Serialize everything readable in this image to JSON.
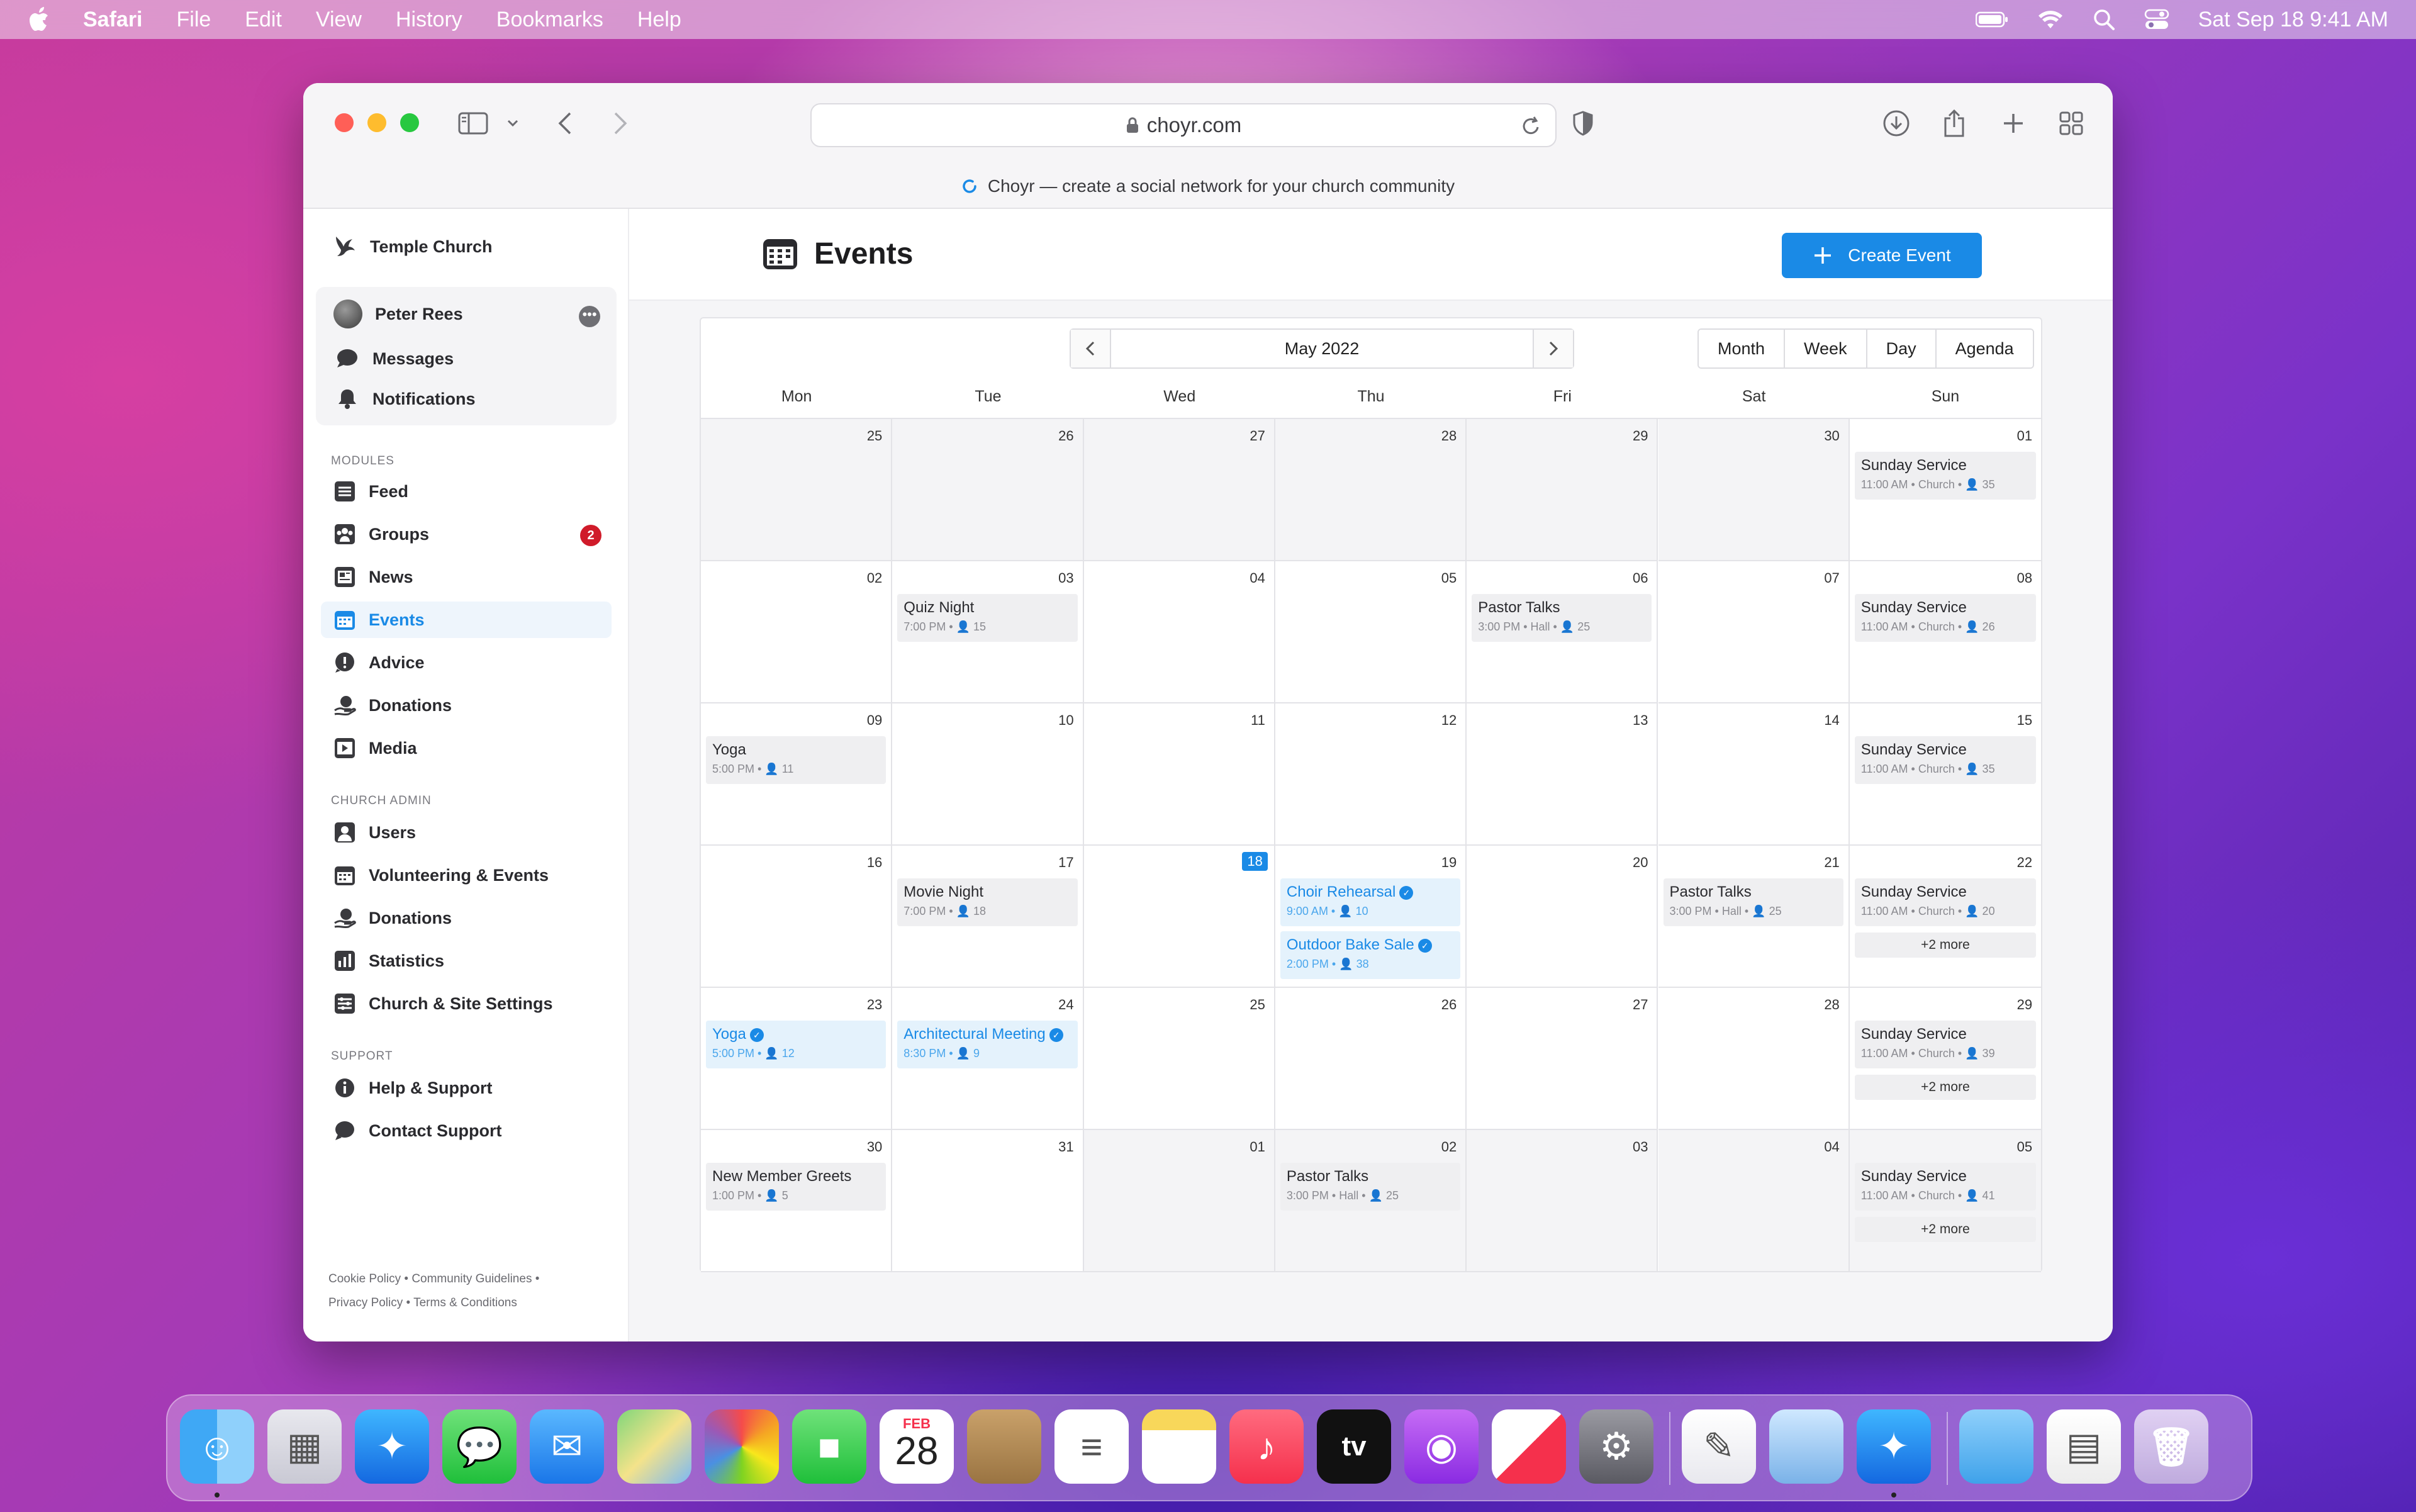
{
  "menubar": {
    "app": "Safari",
    "items": [
      "File",
      "Edit",
      "View",
      "History",
      "Bookmarks",
      "Help"
    ],
    "clock": "Sat Sep 18  9:41 AM"
  },
  "browser": {
    "url": "choyr.com",
    "tab_title": "Choyr — create a social network for your church community"
  },
  "sidebar": {
    "brand": "Temple Church",
    "user": "Peter Rees",
    "user_links": [
      "Messages",
      "Notifications"
    ],
    "sections": {
      "modules": "MODULES",
      "admin": "CHURCH ADMIN",
      "support": "SUPPORT"
    },
    "modules": [
      {
        "label": "Feed",
        "icon": "feed-icon"
      },
      {
        "label": "Groups",
        "icon": "groups-icon",
        "badge": "2"
      },
      {
        "label": "News",
        "icon": "news-icon"
      },
      {
        "label": "Events",
        "icon": "calendar-icon",
        "active": true
      },
      {
        "label": "Advice",
        "icon": "advice-icon"
      },
      {
        "label": "Donations",
        "icon": "donations-icon"
      },
      {
        "label": "Media",
        "icon": "media-icon"
      }
    ],
    "admin": [
      {
        "label": "Users",
        "icon": "users-icon"
      },
      {
        "label": "Volunteering & Events",
        "icon": "calendar-icon"
      },
      {
        "label": "Donations",
        "icon": "donations-icon"
      },
      {
        "label": "Statistics",
        "icon": "statistics-icon"
      },
      {
        "label": "Church & Site Settings",
        "icon": "settings-icon"
      }
    ],
    "support": [
      {
        "label": "Help & Support",
        "icon": "info-icon"
      },
      {
        "label": "Contact Support",
        "icon": "chat-icon"
      }
    ],
    "footer": {
      "line1": "Cookie Policy  •  Community Guidelines  •",
      "line2": "Privacy Policy  •  Terms & Conditions"
    }
  },
  "page": {
    "title": "Events",
    "create_label": "Create Event"
  },
  "calendar": {
    "month_label": "May 2022",
    "views": [
      "Month",
      "Week",
      "Day",
      "Agenda"
    ],
    "weekdays": [
      "Mon",
      "Tue",
      "Wed",
      "Thu",
      "Fri",
      "Sat",
      "Sun"
    ],
    "weeks": [
      [
        {
          "day": "25",
          "out": true
        },
        {
          "day": "26",
          "out": true
        },
        {
          "day": "27",
          "out": true
        },
        {
          "day": "28",
          "out": true
        },
        {
          "day": "29",
          "out": true
        },
        {
          "day": "30",
          "out": true
        },
        {
          "day": "01",
          "events": [
            {
              "title": "Sunday Service",
              "meta": "11:00 AM  •  Church  •  👤 35"
            }
          ]
        }
      ],
      [
        {
          "day": "02"
        },
        {
          "day": "03",
          "events": [
            {
              "title": "Quiz Night",
              "meta": "7:00 PM  •  👤 15"
            }
          ]
        },
        {
          "day": "04"
        },
        {
          "day": "05"
        },
        {
          "day": "06",
          "events": [
            {
              "title": "Pastor Talks",
              "meta": "3:00 PM  •  Hall  •  👤 25"
            }
          ]
        },
        {
          "day": "07"
        },
        {
          "day": "08",
          "events": [
            {
              "title": "Sunday Service",
              "meta": "11:00 AM  •  Church  •  👤 26"
            }
          ]
        }
      ],
      [
        {
          "day": "09",
          "events": [
            {
              "title": "Yoga",
              "meta": "5:00 PM  •  👤 11"
            }
          ]
        },
        {
          "day": "10"
        },
        {
          "day": "11"
        },
        {
          "day": "12"
        },
        {
          "day": "13"
        },
        {
          "day": "14"
        },
        {
          "day": "15",
          "events": [
            {
              "title": "Sunday Service",
              "meta": "11:00 AM  •  Church  •  👤 35"
            }
          ]
        }
      ],
      [
        {
          "day": "16"
        },
        {
          "day": "17",
          "events": [
            {
              "title": "Movie Night",
              "meta": "7:00 PM  •  👤 18"
            }
          ]
        },
        {
          "day": "18",
          "today": true
        },
        {
          "day": "19",
          "events": [
            {
              "title": "Choir Rehearsal",
              "meta": "9:00 AM  •  👤 10",
              "joined": true
            },
            {
              "title": "Outdoor Bake Sale",
              "meta": "2:00 PM  •  👤 38",
              "joined": true
            }
          ]
        },
        {
          "day": "20"
        },
        {
          "day": "21",
          "events": [
            {
              "title": "Pastor Talks",
              "meta": "3:00 PM  •  Hall  •  👤 25"
            }
          ]
        },
        {
          "day": "22",
          "events": [
            {
              "title": "Sunday Service",
              "meta": "11:00 AM  •  Church  •  👤 20"
            }
          ],
          "more": "+2 more"
        }
      ],
      [
        {
          "day": "23",
          "events": [
            {
              "title": "Yoga",
              "meta": "5:00 PM  •  👤 12",
              "joined": true
            }
          ]
        },
        {
          "day": "24",
          "events": [
            {
              "title": "Architectural Meeting",
              "meta": "8:30 PM  •  👤 9",
              "joined": true
            }
          ]
        },
        {
          "day": "25"
        },
        {
          "day": "26"
        },
        {
          "day": "27"
        },
        {
          "day": "28"
        },
        {
          "day": "29",
          "events": [
            {
              "title": "Sunday Service",
              "meta": "11:00 AM  •  Church  •  👤 39"
            }
          ],
          "more": "+2 more"
        }
      ],
      [
        {
          "day": "30",
          "events": [
            {
              "title": "New Member Greets",
              "meta": "1:00 PM  •  👤 5"
            }
          ]
        },
        {
          "day": "31"
        },
        {
          "day": "01",
          "out": true
        },
        {
          "day": "02",
          "out": true,
          "events": [
            {
              "title": "Pastor Talks",
              "meta": "3:00 PM  •  Hall  •  👤 25"
            }
          ]
        },
        {
          "day": "03",
          "out": true
        },
        {
          "day": "04",
          "out": true
        },
        {
          "day": "05",
          "out": true,
          "events": [
            {
              "title": "Sunday Service",
              "meta": "11:00 AM  •  Church  •  👤 41"
            }
          ],
          "more": "+2 more"
        }
      ]
    ]
  },
  "dock": {
    "calendar_month": "FEB",
    "calendar_day": "28",
    "apps": [
      "finder",
      "launchpad",
      "safari",
      "messages",
      "mail",
      "maps",
      "photos",
      "facetime",
      "calendar",
      "contacts",
      "reminders",
      "notes",
      "music",
      "tv",
      "podcasts",
      "news",
      "system-preferences",
      "textedit",
      "preview",
      "safari-2",
      "folder",
      "document",
      "trash"
    ]
  },
  "colors": {
    "accent": "#1a8ae6",
    "badge": "#d01b2a"
  }
}
